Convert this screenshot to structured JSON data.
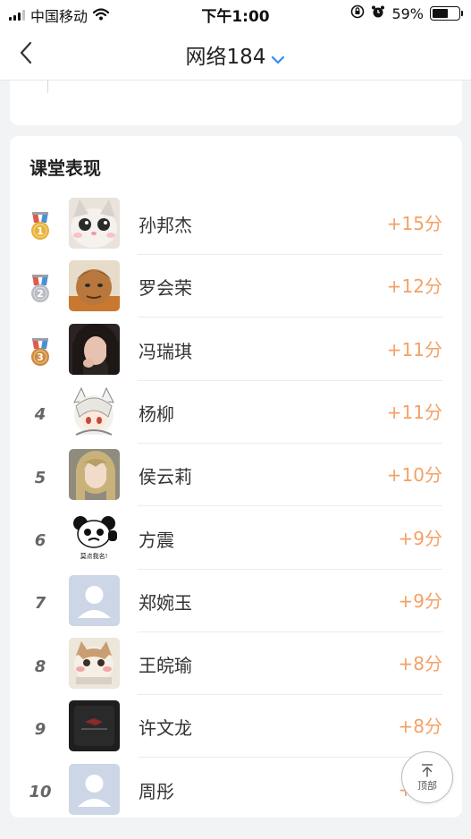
{
  "status_bar": {
    "carrier": "中国移动",
    "time": "下午1:00",
    "battery_percent": "59%",
    "battery_level": 0.59
  },
  "nav": {
    "title": "网络184"
  },
  "section": {
    "title": "课堂表现"
  },
  "colors": {
    "score": "#f5a064",
    "gold": "#e8b23a",
    "silver": "#b9bcc2",
    "bronze": "#d08a3b",
    "ribbon_red": "#e05a4f",
    "ribbon_blue": "#4a90d9"
  },
  "ranking": [
    {
      "rank": "1",
      "medal": "gold",
      "name": "孙邦杰",
      "score": "+15分",
      "avatar": "cat-avatar"
    },
    {
      "rank": "2",
      "medal": "silver",
      "name": "罗会荣",
      "score": "+12分",
      "avatar": "cartoon-man-avatar"
    },
    {
      "rank": "3",
      "medal": "bronze",
      "name": "冯瑞琪",
      "score": "+11分",
      "avatar": "girl-photo-avatar"
    },
    {
      "rank": "4",
      "medal": "",
      "name": "杨柳",
      "score": "+11分",
      "avatar": "anime-girl-avatar"
    },
    {
      "rank": "5",
      "medal": "",
      "name": "侯云莉",
      "score": "+10分",
      "avatar": "blonde-girl-avatar"
    },
    {
      "rank": "6",
      "medal": "",
      "name": "方震",
      "score": "+9分",
      "avatar": "panda-meme-avatar"
    },
    {
      "rank": "7",
      "medal": "",
      "name": "郑婉玉",
      "score": "+9分",
      "avatar": "default-avatar"
    },
    {
      "rank": "8",
      "medal": "",
      "name": "王皖瑜",
      "score": "+8分",
      "avatar": "cat-blush-avatar"
    },
    {
      "rank": "9",
      "medal": "",
      "name": "许文龙",
      "score": "+8分",
      "avatar": "dark-logo-avatar"
    },
    {
      "rank": "10",
      "medal": "",
      "name": "周彤",
      "score": "+8分",
      "avatar": "default-avatar"
    }
  ],
  "panda_caption": "莫点我名!",
  "back_to_top": {
    "label": "顶部",
    "icon": "arrow-up-icon"
  }
}
